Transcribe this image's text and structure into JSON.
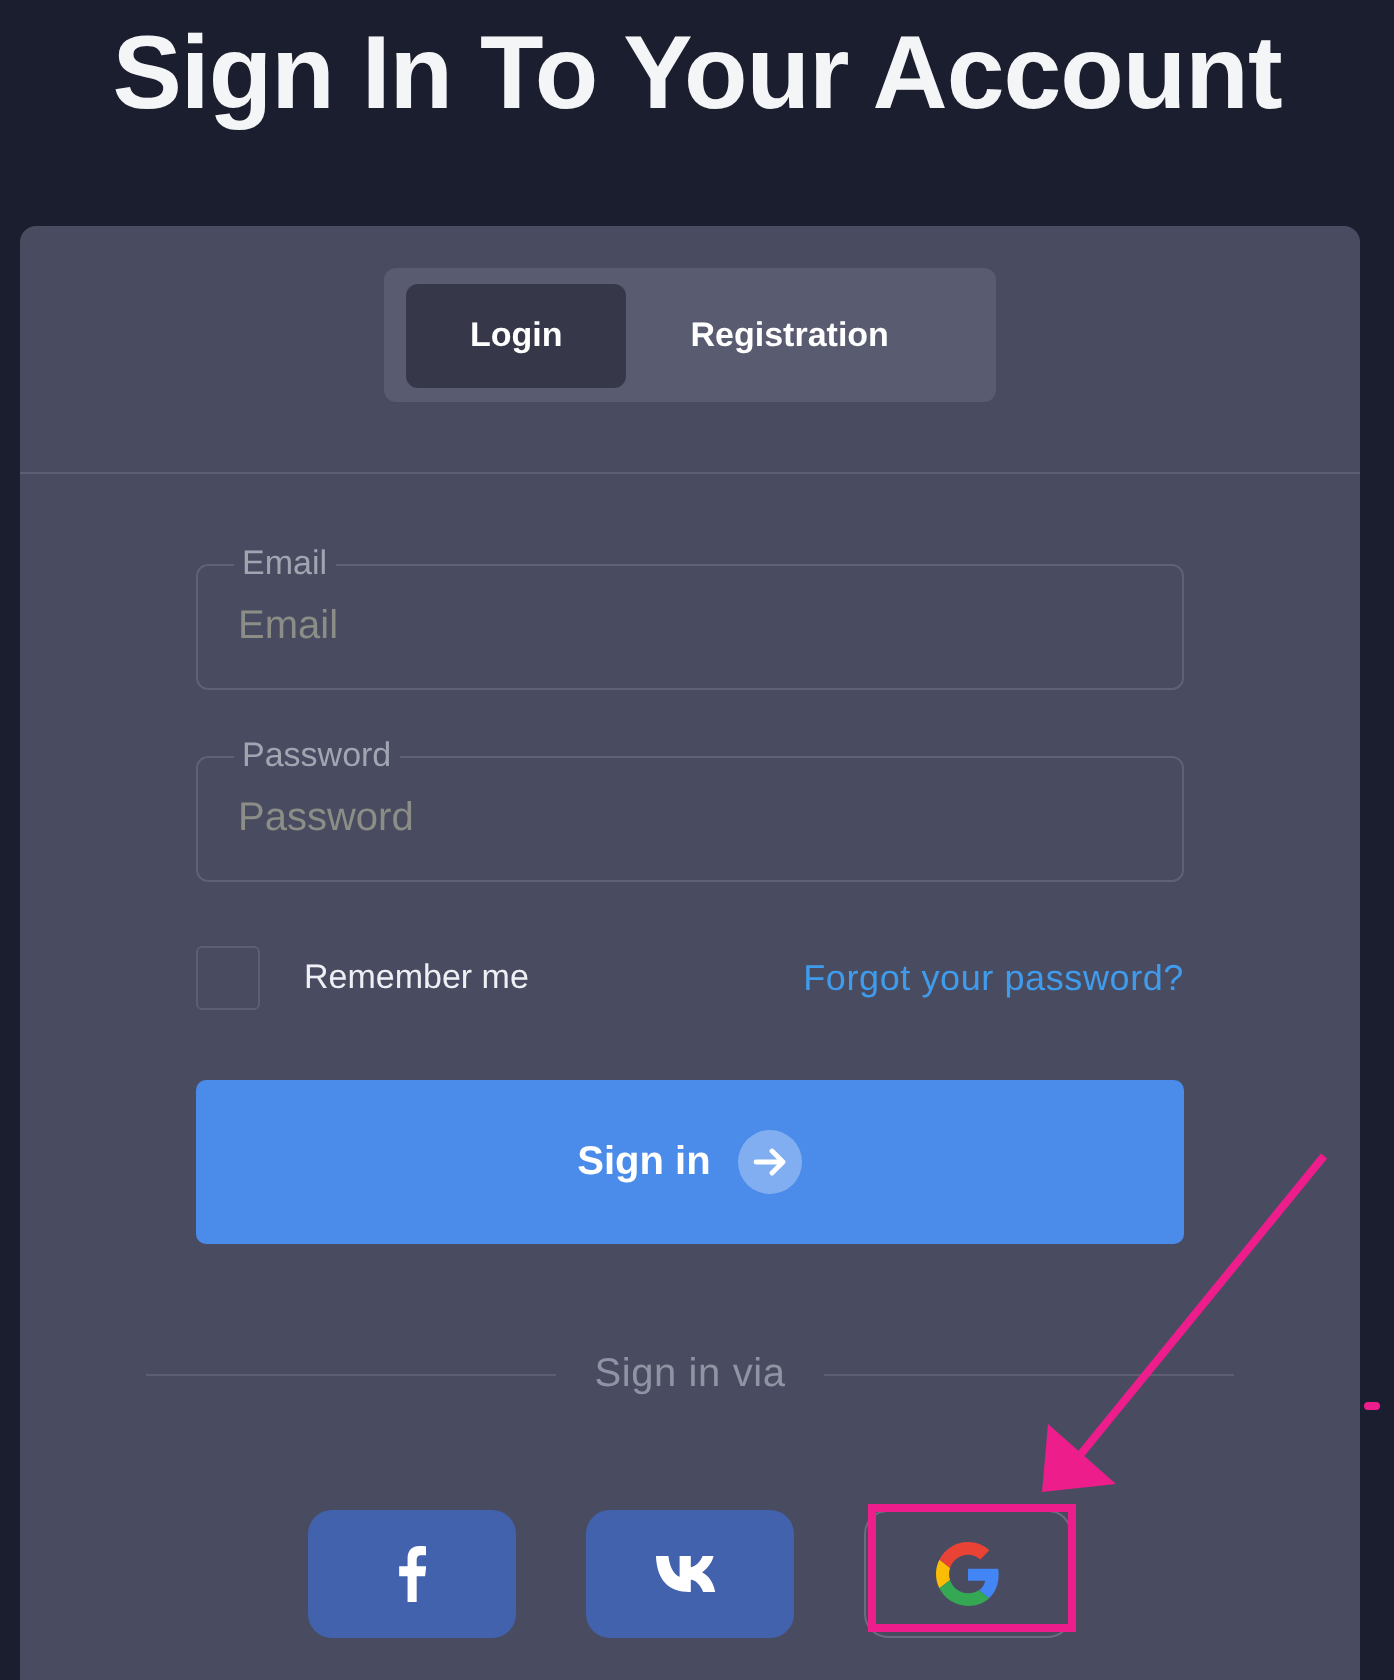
{
  "page": {
    "title": "Sign In To Your Account"
  },
  "tabs": [
    {
      "label": "Login",
      "selected": true
    },
    {
      "label": "Registration",
      "selected": false
    }
  ],
  "fields": [
    {
      "label": "Email",
      "placeholder": "Email"
    },
    {
      "label": "Password",
      "placeholder": "Password"
    }
  ],
  "remember_me": {
    "label": "Remember me",
    "checked": false
  },
  "forgot_link": {
    "label": "Forgot your password?"
  },
  "submit_button": {
    "label": "Sign in"
  },
  "social": {
    "caption": "Sign in via",
    "buttons": [
      {
        "kind": "facebook",
        "highlighted": false
      },
      {
        "kind": "vk",
        "highlighted": false
      },
      {
        "kind": "google",
        "highlighted": true
      }
    ]
  }
}
